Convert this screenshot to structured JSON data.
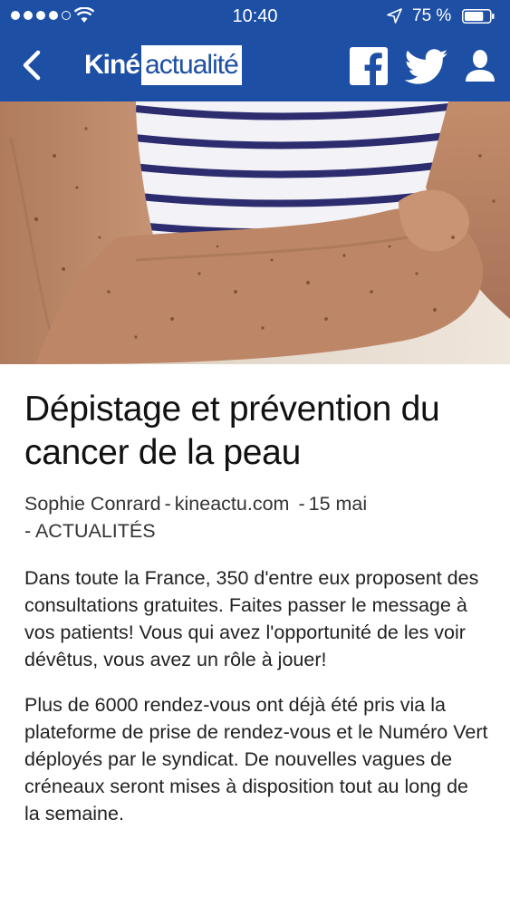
{
  "status_bar": {
    "time": "10:40",
    "battery_percent": "75 %",
    "battery_level": 0.75,
    "signal_bars_filled": 4,
    "signal_bars_total": 5
  },
  "nav": {
    "logo_part1": "Kiné",
    "logo_part2": "actualité",
    "icons": [
      "back-icon",
      "facebook-icon",
      "twitter-icon",
      "user-icon"
    ]
  },
  "article": {
    "title": "Dépistage et prévention du cancer de la peau",
    "author": "Sophie Conrard",
    "source": "kineactu.com",
    "date": "15 mai",
    "category": "ACTUALITÉS",
    "separator": "-",
    "paragraphs": [
      "Dans toute la France, 350 d'entre eux proposent des consultations gratuites. Faites passer le message à vos patients! Vous qui avez l'opportunité de les voir dévêtus, vous avez un rôle à jouer!",
      "Plus de 6000 rendez-vous ont déjà été pris via la plateforme de prise de rendez-vous et le Numéro Vert déployés par le syndicat. De nouvelles vagues de créneaux seront mises à disposition tout au long de la semaine."
    ]
  },
  "colors": {
    "brand_blue": "#1d4fa5",
    "text": "#222222",
    "stripe": "#2c2c6e",
    "skin": "#b5805f"
  }
}
